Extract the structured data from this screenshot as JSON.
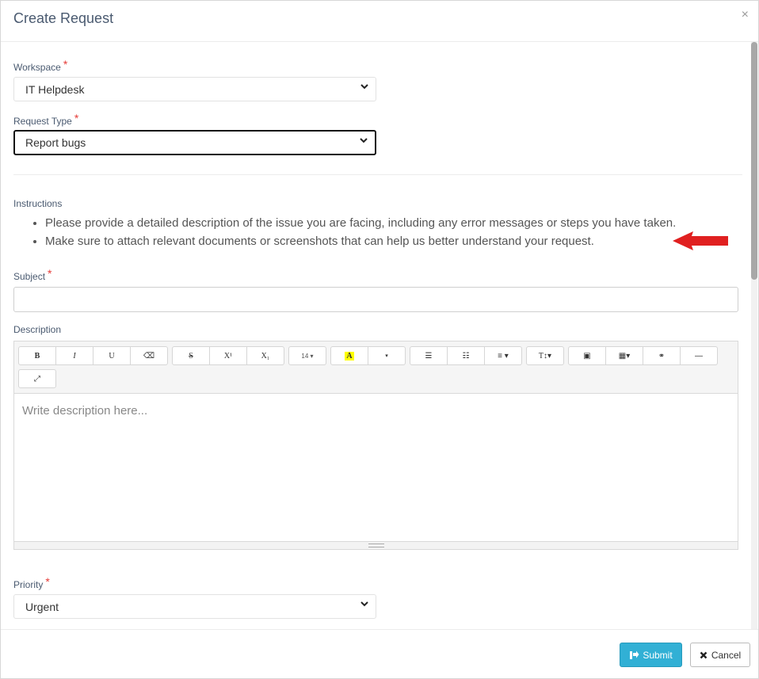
{
  "header": {
    "title": "Create Request",
    "close_glyph": "×"
  },
  "workspace": {
    "label": "Workspace",
    "required_mark": "*",
    "value": "IT Helpdesk"
  },
  "request_type": {
    "label": "Request Type",
    "required_mark": "*",
    "value": "Report bugs"
  },
  "instructions": {
    "label": "Instructions",
    "items": [
      "Please provide a detailed description of the issue you are facing, including any error messages or steps you have taken.",
      "Make sure to attach relevant documents or screenshots that can help us better understand your request."
    ]
  },
  "subject": {
    "label": "Subject",
    "required_mark": "*",
    "value": ""
  },
  "description": {
    "label": "Description",
    "placeholder": "Write description here...",
    "toolbar": {
      "bold": "B",
      "italic": "I",
      "underline": "U",
      "clear_format": "⌫",
      "strike": "S",
      "superscript": "X¹",
      "subscript": "X₁",
      "font_size": "14 ▾",
      "highlight": "A",
      "color_dropdown": "▾",
      "bullet_list": "☰",
      "numbered_list": "☷",
      "align": "≡ ▾",
      "style": "T↕▾",
      "image": "▣",
      "table": "▦▾",
      "link": "⚭",
      "hr": "—",
      "fullscreen": "⤢"
    }
  },
  "priority": {
    "label": "Priority",
    "required_mark": "*",
    "value": "Urgent"
  },
  "footer": {
    "submit_label": "Submit",
    "cancel_label": "Cancel"
  },
  "colors": {
    "accent": "#31b0d5",
    "required": "#e53935",
    "arrow": "#e02020"
  }
}
